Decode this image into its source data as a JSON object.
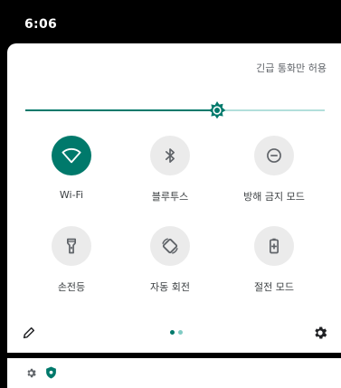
{
  "status_bar": {
    "time": "6:06"
  },
  "header": {
    "carrier_text": "긴급 통화만 허용"
  },
  "brightness": {
    "level_percent": 64
  },
  "tiles": [
    {
      "label": "Wi-Fi",
      "state": "on",
      "icon": "wifi-icon"
    },
    {
      "label": "블루투스",
      "state": "off",
      "icon": "bluetooth-icon"
    },
    {
      "label": "방해 금지 모드",
      "state": "off",
      "icon": "do-not-disturb-icon"
    },
    {
      "label": "손전등",
      "state": "off",
      "icon": "flashlight-icon"
    },
    {
      "label": "자동 회전",
      "state": "off",
      "icon": "auto-rotate-icon"
    },
    {
      "label": "절전 모드",
      "state": "off",
      "icon": "battery-saver-icon"
    }
  ],
  "pager": {
    "pages": 2,
    "current": 1
  },
  "footer": {
    "edit_icon": "pencil-icon",
    "settings_icon": "gear-icon"
  },
  "notification_shelf": {
    "icons": [
      "gear-icon",
      "shield-icon"
    ]
  },
  "colors": {
    "accent": "#00796b",
    "accent_light": "#b2dfdb",
    "tile_off": "#ebebeb",
    "icon_off": "#5f6368",
    "pager_inactive": "#80cbc4"
  }
}
